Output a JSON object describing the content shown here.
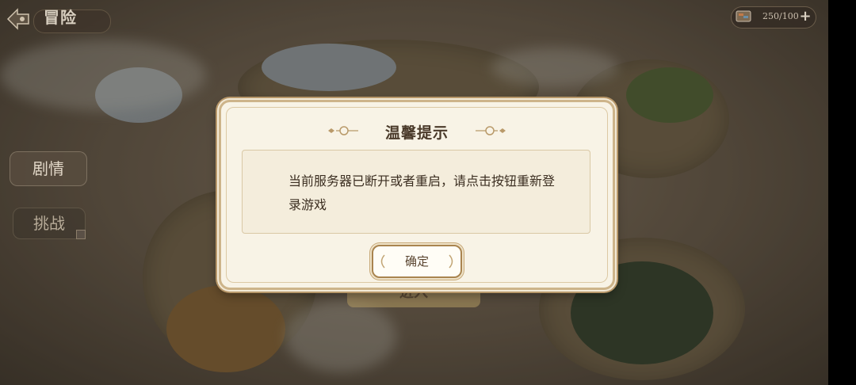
{
  "header": {
    "back_icon": "back-arrow-icon",
    "title": "冒险"
  },
  "resources": {
    "energy_icon": "energy-flag-icon",
    "energy_value": "250/100",
    "add_label": "+"
  },
  "side_tabs": {
    "story": "剧情",
    "challenge": "挑战"
  },
  "map": {
    "enter_label": "进入"
  },
  "dialog": {
    "title": "温馨提示",
    "message": "当前服务器已断开或者重启，请点击按钮重新登录游戏",
    "confirm_label": "确定",
    "accent_color": "#b8986a",
    "background_color": "#f8f3e6"
  }
}
